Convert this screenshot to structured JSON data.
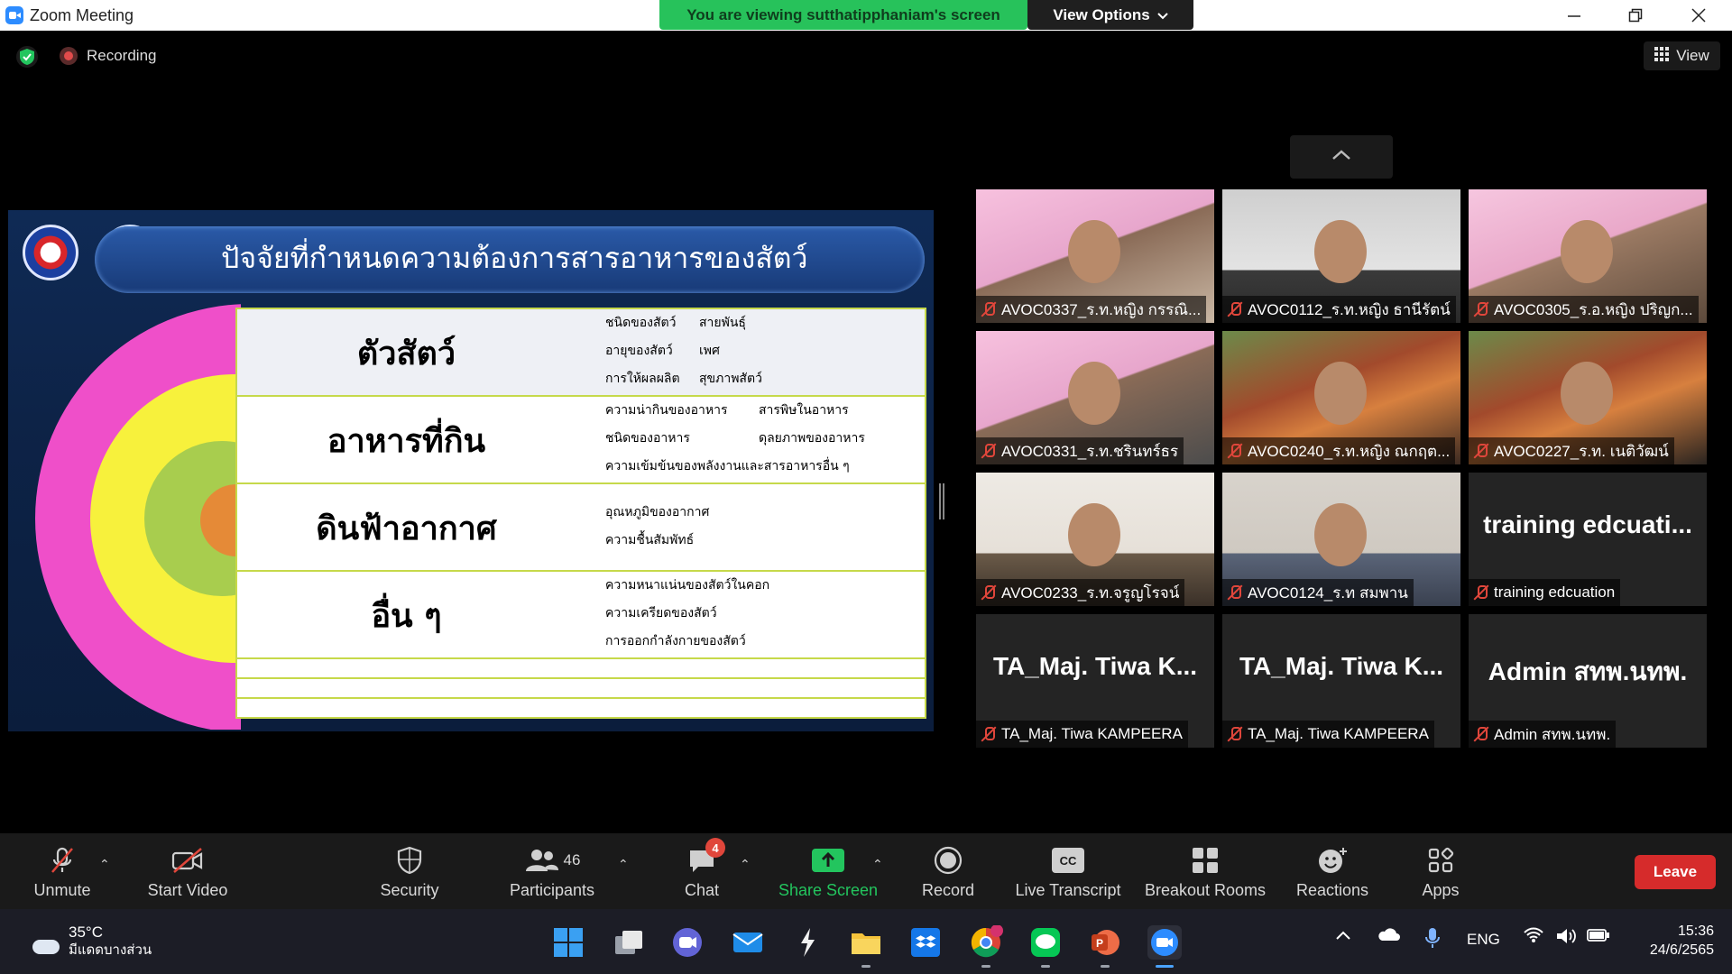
{
  "window": {
    "title": "Zoom Meeting",
    "viewing_banner": "You are viewing sutthatipphaniam's screen",
    "view_options": "View Options"
  },
  "status": {
    "recording": "Recording",
    "view_label": "View"
  },
  "slide": {
    "title": "ปัจจัยที่กำหนดความต้องการสารอาหารของสัตว์",
    "rows": [
      {
        "label": "ตัวสัตว์",
        "details": [
          [
            "ชนิดของสัตว์",
            "สายพันธุ์"
          ],
          [
            "อายุของสัตว์",
            "เพศ"
          ],
          [
            "การให้ผลผลิต",
            "สุขภาพสัตว์"
          ]
        ]
      },
      {
        "label": "อาหารที่กิน",
        "details": [
          [
            "ความน่ากินของอาหาร",
            "สารพิษในอาหาร"
          ],
          [
            "ชนิดของอาหาร",
            "ดุลยภาพของอาหาร"
          ],
          [
            "ความเข้มข้นของพลังงานและสารอาหารอื่น ๆ",
            ""
          ]
        ]
      },
      {
        "label": "ดินฟ้าอากาศ",
        "details": [
          [
            "อุณหภูมิของอากาศ",
            ""
          ],
          [
            "ความชื้นสัมพัทธ์",
            ""
          ]
        ]
      },
      {
        "label": "อื่น ๆ",
        "details": [
          [
            "ความหนาแน่นของสัตว์ในคอก",
            ""
          ],
          [
            "ความเครียดของสัตว์",
            ""
          ],
          [
            "การออกกำลังกายของสัตว์",
            ""
          ]
        ]
      }
    ],
    "arc_colors": [
      "#ef4fc9",
      "#f7f13c",
      "#a8cd4e",
      "#e58a37"
    ]
  },
  "participants": [
    {
      "name": "AVOC0337_ร.ท.หญิง กรรณิ...",
      "big_name": ""
    },
    {
      "name": "AVOC0112_ร.ท.หญิง ธานีรัตน์",
      "big_name": ""
    },
    {
      "name": "AVOC0305_ร.อ.หญิง ปริญก...",
      "big_name": ""
    },
    {
      "name": "AVOC0331_ร.ท.ชรินทร์ธร",
      "big_name": ""
    },
    {
      "name": "AVOC0240_ร.ท.หญิง ณกฤต...",
      "big_name": ""
    },
    {
      "name": "AVOC0227_ร.ท. เนติวัฒน์",
      "big_name": ""
    },
    {
      "name": "AVOC0233_ร.ท.จรูญโรจน์",
      "big_name": ""
    },
    {
      "name": "AVOC0124_ร.ท สมพาน",
      "big_name": ""
    },
    {
      "name": "training edcuation",
      "big_name": "training edcuati..."
    },
    {
      "name": "TA_Maj. Tiwa KAMPEERA",
      "big_name": "TA_Maj. Tiwa K..."
    },
    {
      "name": "TA_Maj. Tiwa KAMPEERA",
      "big_name": "TA_Maj. Tiwa K..."
    },
    {
      "name": "Admin สทพ.นทพ.",
      "big_name": "Admin สทพ.นทพ."
    }
  ],
  "toolbar": {
    "unmute": "Unmute",
    "start_video": "Start Video",
    "security": "Security",
    "participants": "Participants",
    "participants_count": "46",
    "chat": "Chat",
    "chat_badge": "4",
    "share_screen": "Share Screen",
    "record": "Record",
    "live_transcript": "Live Transcript",
    "breakout_rooms": "Breakout Rooms",
    "reactions": "Reactions",
    "apps": "Apps",
    "leave": "Leave",
    "cc": "CC"
  },
  "taskbar": {
    "temperature": "35°C",
    "condition": "มีแดดบางส่วน",
    "language": "ENG",
    "time": "15:36",
    "date": "24/6/2565"
  },
  "colors": {
    "banner_green": "#27c25b",
    "share_green": "#23c55e",
    "leave_red": "#d62b2b",
    "mute_red": "#e0463b"
  }
}
